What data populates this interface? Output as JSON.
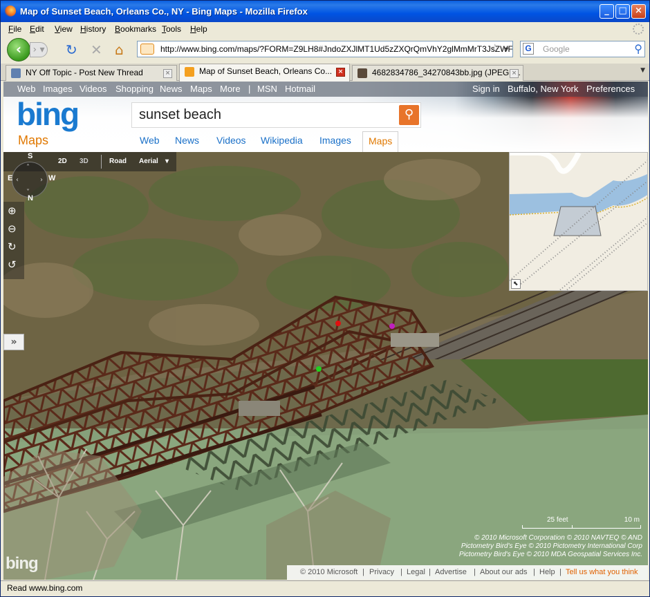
{
  "window": {
    "title": "Map of Sunset Beach, Orleans Co., NY - Bing Maps - Mozilla Firefox",
    "min": "_",
    "max": "□",
    "close": "×"
  },
  "menu": [
    "File",
    "Edit",
    "View",
    "History",
    "Bookmarks",
    "Tools",
    "Help"
  ],
  "nav": {
    "url": "http://www.bing.com/maps/?FORM=Z9LH8#JndoZXJlMT1Ud5zZXQrQmVhY2glMmMrT3JsZWFucyUyMEN",
    "search_placeholder": "Google",
    "search_engine": "G"
  },
  "tabs": [
    {
      "label": "NY Off Topic - Post New Thread",
      "active": false
    },
    {
      "label": "Map of Sunset Beach, Orleans Co...",
      "active": true
    },
    {
      "label": "4682834786_34270843bb.jpg (JPEG I...",
      "active": false
    }
  ],
  "bing": {
    "topnav_left": [
      "Web",
      "Images",
      "Videos",
      "Shopping",
      "News",
      "Maps",
      "More",
      "|",
      "MSN",
      "Hotmail"
    ],
    "topnav_right": [
      "Sign in",
      "Buffalo, New York",
      "Preferences"
    ],
    "logo": "bing",
    "section": "Maps",
    "query": "sunset beach",
    "scopes": [
      "Web",
      "News",
      "Videos",
      "Wikipedia",
      "Images",
      "Maps"
    ],
    "active_scope": "Maps"
  },
  "map": {
    "view_modes": [
      "2D",
      "3D",
      "Road",
      "Aerial"
    ],
    "active_view": "Aerial",
    "compass": {
      "top": "S",
      "left": "E",
      "right": "W",
      "bottom": "N"
    },
    "scale": {
      "left": "25 feet",
      "right": "10 m"
    },
    "copyright": [
      "© 2010 Microsoft Corporation   © 2010 NAVTEQ   © AND",
      "Pictometry Bird's Eye © 2010 Pictometry International Corp",
      "Pictometry Bird's Eye © 2010 MDA Geospatial Services Inc."
    ],
    "watermark": "bing",
    "footer": [
      "© 2010 Microsoft",
      "|",
      "Privacy",
      "|",
      "Legal",
      "|",
      "Advertise",
      "|",
      "About our ads",
      "|",
      "Help",
      "|",
      "Tell us what you think"
    ]
  },
  "status": "Read www.bing.com"
}
